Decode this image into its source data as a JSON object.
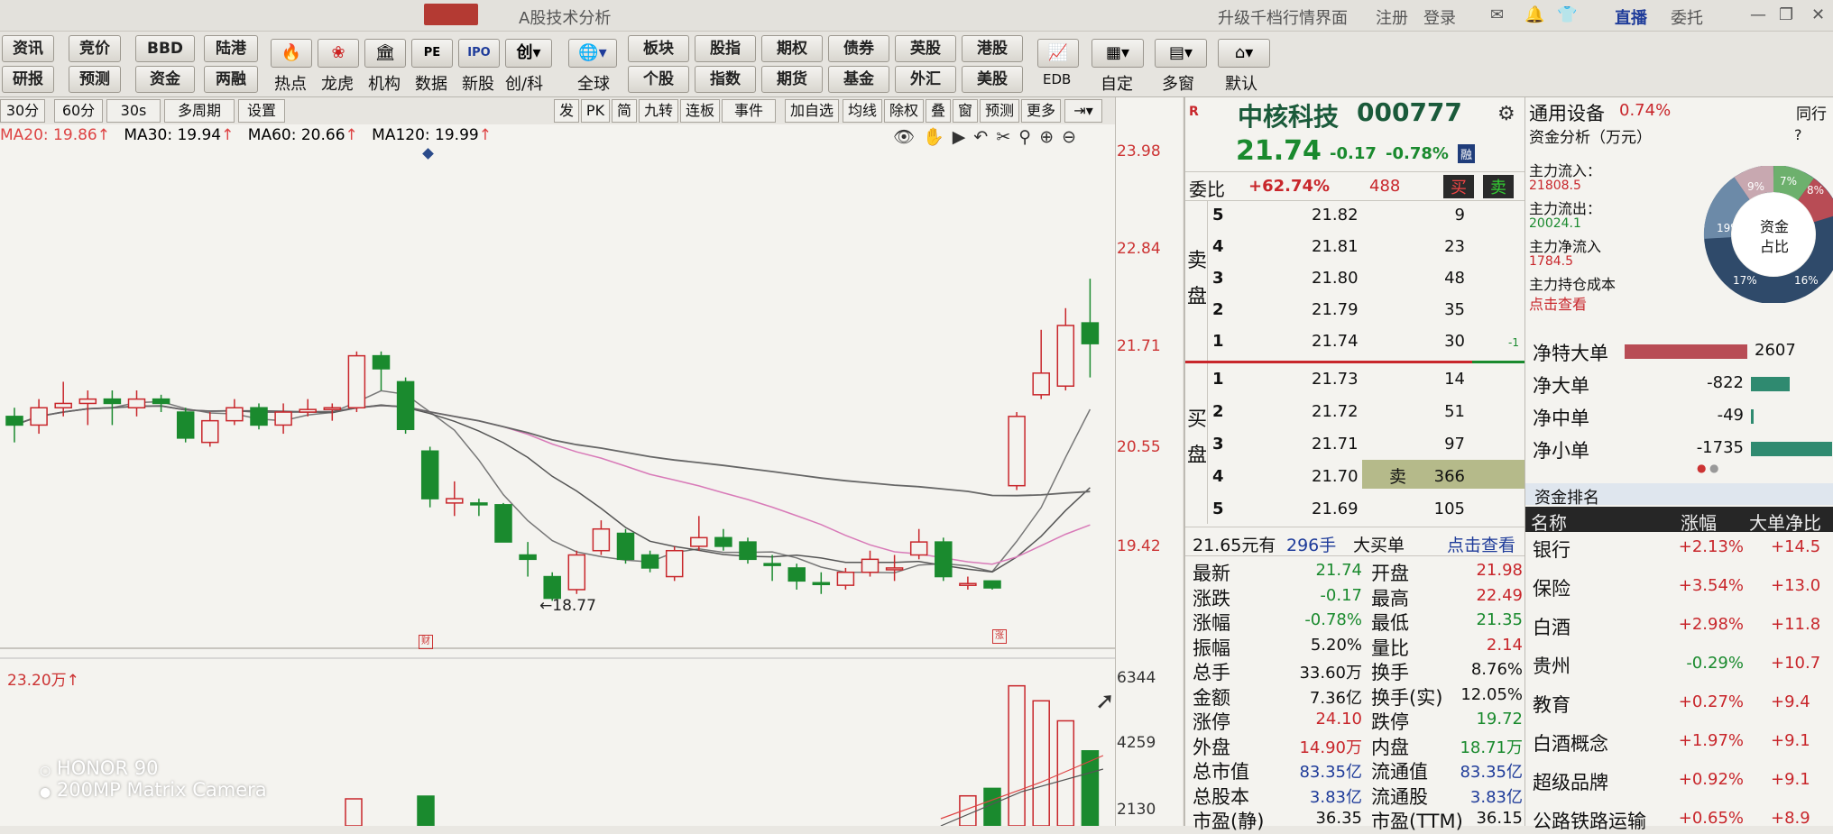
{
  "titlebar": {
    "window_title": "A股技术分析",
    "upgrade": "升级千档行情界面",
    "register": "注册",
    "login": "登录",
    "live": "直播",
    "entrust": "委托"
  },
  "toolbar": {
    "row1": [
      "资讯",
      "竞价",
      "BBD",
      "陆港"
    ],
    "row2": [
      "研报",
      "预测",
      "资金",
      "两融"
    ],
    "icons": [
      "热点",
      "龙虎",
      "机构",
      "数据",
      "新股",
      "创/科",
      "全球"
    ],
    "group_row1": [
      "板块",
      "股指",
      "期权",
      "债券",
      "英股",
      "港股"
    ],
    "group_row2": [
      "个股",
      "指数",
      "期货",
      "基金",
      "外汇",
      "美股"
    ],
    "right_icons": [
      "EDB",
      "自定",
      "多窗",
      "默认"
    ]
  },
  "chart_toolbar": {
    "left": [
      "30分",
      "60分",
      "30s",
      "多周期",
      "设置"
    ],
    "right": [
      "发",
      "PK",
      "简",
      "九转",
      "连板",
      "事件",
      "加自选",
      "均线",
      "除权",
      "叠",
      "窗",
      "预测",
      "更多"
    ]
  },
  "ma_legend": [
    {
      "label": "MA20: 19.86",
      "color": "#d44"
    },
    {
      "label": "MA30: 19.94",
      "color": "#222"
    },
    {
      "label": "MA60: 20.66",
      "color": "#222"
    },
    {
      "label": "MA120: 19.99",
      "color": "#222"
    }
  ],
  "price_axis": [
    "23.98",
    "22.84",
    "21.71",
    "20.55",
    "19.42"
  ],
  "volume_axis": [
    "6344",
    "4259",
    "2130"
  ],
  "low_marker": "18.77",
  "volume_label": "23.20万",
  "candles": [
    {
      "o": 20.9,
      "c": 20.8,
      "h": 21.0,
      "l": 20.6
    },
    {
      "o": 20.8,
      "c": 21.0,
      "h": 21.1,
      "l": 20.7
    },
    {
      "o": 21.0,
      "c": 21.05,
      "h": 21.3,
      "l": 20.9
    },
    {
      "o": 21.05,
      "c": 21.1,
      "h": 21.2,
      "l": 20.8
    },
    {
      "o": 21.1,
      "c": 21.05,
      "h": 21.2,
      "l": 20.8
    },
    {
      "o": 21.0,
      "c": 21.1,
      "h": 21.2,
      "l": 20.9
    },
    {
      "o": 21.1,
      "c": 21.05,
      "h": 21.15,
      "l": 20.95
    },
    {
      "o": 20.95,
      "c": 20.65,
      "h": 21.0,
      "l": 20.6
    },
    {
      "o": 20.6,
      "c": 20.85,
      "h": 20.95,
      "l": 20.55
    },
    {
      "o": 20.85,
      "c": 21.0,
      "h": 21.1,
      "l": 20.8
    },
    {
      "o": 21.0,
      "c": 20.8,
      "h": 21.05,
      "l": 20.75
    },
    {
      "o": 20.8,
      "c": 20.95,
      "h": 21.05,
      "l": 20.7
    },
    {
      "o": 20.95,
      "c": 20.98,
      "h": 21.1,
      "l": 20.9
    },
    {
      "o": 20.98,
      "c": 21.0,
      "h": 21.05,
      "l": 20.85
    },
    {
      "o": 21.0,
      "c": 21.6,
      "h": 21.65,
      "l": 20.95
    },
    {
      "o": 21.6,
      "c": 21.45,
      "h": 21.65,
      "l": 21.2
    },
    {
      "o": 21.3,
      "c": 20.75,
      "h": 21.35,
      "l": 20.7
    },
    {
      "o": 20.5,
      "c": 19.95,
      "h": 20.55,
      "l": 19.85
    },
    {
      "o": 19.9,
      "c": 19.95,
      "h": 20.15,
      "l": 19.75
    },
    {
      "o": 19.9,
      "c": 19.88,
      "h": 19.95,
      "l": 19.75
    },
    {
      "o": 19.88,
      "c": 19.45,
      "h": 19.9,
      "l": 19.45
    },
    {
      "o": 19.3,
      "c": 19.25,
      "h": 19.45,
      "l": 19.05
    },
    {
      "o": 19.05,
      "c": 18.8,
      "h": 19.1,
      "l": 18.77
    },
    {
      "o": 18.9,
      "c": 19.3,
      "h": 19.35,
      "l": 18.85
    },
    {
      "o": 19.35,
      "c": 19.6,
      "h": 19.7,
      "l": 19.3
    },
    {
      "o": 19.55,
      "c": 19.25,
      "h": 19.6,
      "l": 19.2
    },
    {
      "o": 19.3,
      "c": 19.15,
      "h": 19.35,
      "l": 19.1
    },
    {
      "o": 19.05,
      "c": 19.35,
      "h": 19.4,
      "l": 19.0
    },
    {
      "o": 19.4,
      "c": 19.5,
      "h": 19.75,
      "l": 19.35
    },
    {
      "o": 19.5,
      "c": 19.4,
      "h": 19.6,
      "l": 19.35
    },
    {
      "o": 19.45,
      "c": 19.25,
      "h": 19.5,
      "l": 19.2
    },
    {
      "o": 19.2,
      "c": 19.18,
      "h": 19.3,
      "l": 19.0
    },
    {
      "o": 19.15,
      "c": 19.0,
      "h": 19.2,
      "l": 18.9
    },
    {
      "o": 18.98,
      "c": 18.97,
      "h": 19.1,
      "l": 18.85
    },
    {
      "o": 18.95,
      "c": 19.1,
      "h": 19.15,
      "l": 18.9
    },
    {
      "o": 19.1,
      "c": 19.25,
      "h": 19.35,
      "l": 19.05
    },
    {
      "o": 19.15,
      "c": 19.15,
      "h": 19.3,
      "l": 19.0
    },
    {
      "o": 19.3,
      "c": 19.45,
      "h": 19.6,
      "l": 19.25
    },
    {
      "o": 19.45,
      "c": 19.05,
      "h": 19.5,
      "l": 19.0
    },
    {
      "o": 18.97,
      "c": 18.97,
      "h": 19.05,
      "l": 18.9
    },
    {
      "o": 19.0,
      "c": 18.92,
      "h": 19.0,
      "l": 18.9
    },
    {
      "o": 20.1,
      "c": 20.9,
      "h": 20.95,
      "l": 20.05
    },
    {
      "o": 21.15,
      "c": 21.4,
      "h": 21.9,
      "l": 21.1
    },
    {
      "o": 21.25,
      "c": 21.95,
      "h": 22.15,
      "l": 21.2
    },
    {
      "o": 21.98,
      "c": 21.74,
      "h": 22.49,
      "l": 21.35
    }
  ],
  "volume_bars": [
    {
      "v": 1200,
      "up": true
    },
    {
      "v": 1500,
      "up": false
    },
    {
      "v": 5600,
      "up": true
    },
    {
      "v": 5000,
      "up": true
    },
    {
      "v": 4200,
      "up": true
    },
    {
      "v": 3000,
      "up": false
    }
  ],
  "stock": {
    "name": "中核科技",
    "code": "000777",
    "price": "21.74",
    "change": "-0.17",
    "change_pct": "-0.78%",
    "tag": "融"
  },
  "weibi": {
    "label": "委比",
    "pct": "+62.74%",
    "diff": "488",
    "buy_btn": "买",
    "sell_btn": "卖"
  },
  "asks": [
    {
      "lvl": "5",
      "price": "21.82",
      "vol": "9"
    },
    {
      "lvl": "4",
      "price": "21.81",
      "vol": "23"
    },
    {
      "lvl": "3",
      "price": "21.80",
      "vol": "48"
    },
    {
      "lvl": "2",
      "price": "21.79",
      "vol": "35"
    },
    {
      "lvl": "1",
      "price": "21.74",
      "vol": "30"
    }
  ],
  "ask_note": "-1",
  "bids": [
    {
      "lvl": "1",
      "price": "21.73",
      "vol": "14"
    },
    {
      "lvl": "2",
      "price": "21.72",
      "vol": "51"
    },
    {
      "lvl": "3",
      "price": "21.71",
      "vol": "97"
    },
    {
      "lvl": "4",
      "price": "21.70",
      "vol": "366"
    },
    {
      "lvl": "5",
      "price": "21.69",
      "vol": "105"
    }
  ],
  "sell_label_ask": "卖盘",
  "buy_label_bid": "买盘",
  "sell_tag": "卖",
  "big_order": {
    "price": "21.65元有",
    "qty": "296手",
    "label": "大买单",
    "link": "点击查看"
  },
  "stats_left": [
    {
      "k": "最新",
      "v": "21.74",
      "c": "green"
    },
    {
      "k": "涨跌",
      "v": "-0.17",
      "c": "green"
    },
    {
      "k": "涨幅",
      "v": "-0.78%",
      "c": "green"
    },
    {
      "k": "振幅",
      "v": "5.20%",
      "c": "blk"
    },
    {
      "k": "总手",
      "v": "33.60万",
      "c": "blk"
    },
    {
      "k": "金额",
      "v": "7.36亿",
      "c": "blk"
    },
    {
      "k": "涨停",
      "v": "24.10",
      "c": "red"
    },
    {
      "k": "外盘",
      "v": "14.90万",
      "c": "red"
    },
    {
      "k": "总市值",
      "v": "83.35亿",
      "c": "blue"
    },
    {
      "k": "总股本",
      "v": "3.83亿",
      "c": "blue"
    },
    {
      "k": "市盈(静)",
      "v": "36.35",
      "c": "blk"
    }
  ],
  "stats_right": [
    {
      "k": "开盘",
      "v": "21.98",
      "c": "red"
    },
    {
      "k": "最高",
      "v": "22.49",
      "c": "red"
    },
    {
      "k": "最低",
      "v": "21.35",
      "c": "green"
    },
    {
      "k": "量比",
      "v": "2.14",
      "c": "red"
    },
    {
      "k": "换手",
      "v": "8.76%",
      "c": "blk"
    },
    {
      "k": "换手(实)",
      "v": "12.05%",
      "c": "blk"
    },
    {
      "k": "跌停",
      "v": "19.72",
      "c": "green"
    },
    {
      "k": "内盘",
      "v": "18.71万",
      "c": "green"
    },
    {
      "k": "流通值",
      "v": "83.35亿",
      "c": "blue"
    },
    {
      "k": "流通股",
      "v": "3.83亿",
      "c": "blue"
    },
    {
      "k": "市盈(TTM)",
      "v": "36.15",
      "c": "blk"
    }
  ],
  "right": {
    "sector": "通用设备",
    "sector_pct": "0.74%",
    "sector_more": "同行",
    "fund_title": "资金分析（万元）",
    "help": "?",
    "main_in_label": "主力流入：",
    "main_in": "21808.5",
    "main_out_label": "主力流出：",
    "main_out": "20024.1",
    "main_net_label": "主力净流入",
    "main_net": "1784.5",
    "main_cost_label": "主力持仓成本",
    "main_cost_link": "点击查看",
    "donut_center": [
      "资金",
      "占比"
    ],
    "donut_pcts": [
      "9%",
      "7%",
      "8%",
      "19%",
      "17%",
      "16%"
    ],
    "flows": [
      {
        "k": "净特大单",
        "v": "2607",
        "sign": "pos",
        "frac": 0.8
      },
      {
        "k": "净大单",
        "v": "-822",
        "sign": "neg",
        "frac": 0.25
      },
      {
        "k": "净中单",
        "v": "-49",
        "sign": "neg",
        "frac": 0.02
      },
      {
        "k": "净小单",
        "v": "-1735",
        "sign": "neg",
        "frac": 0.53
      }
    ],
    "rank_title": "资金排名",
    "rank_headers": [
      "名称",
      "涨幅",
      "大单净比"
    ],
    "rank_rows": [
      {
        "name": "银行",
        "pct": "+2.13%",
        "net": "+14.5"
      },
      {
        "name": "保险",
        "pct": "+3.54%",
        "net": "+13.0"
      },
      {
        "name": "白酒",
        "pct": "+2.98%",
        "net": "+11.8"
      },
      {
        "name": "贵州",
        "pct": "-0.29%",
        "net": "+10.7"
      },
      {
        "name": "教育",
        "pct": "+0.27%",
        "net": "+9.4"
      },
      {
        "name": "白酒概念",
        "pct": "+1.97%",
        "net": "+9.1"
      },
      {
        "name": "超级品牌",
        "pct": "+0.92%",
        "net": "+9.1"
      },
      {
        "name": "公路铁路运输",
        "pct": "+0.65%",
        "net": "+8.9"
      }
    ]
  },
  "watermark": [
    "HONOR 90",
    "200MP Matrix Camera"
  ]
}
